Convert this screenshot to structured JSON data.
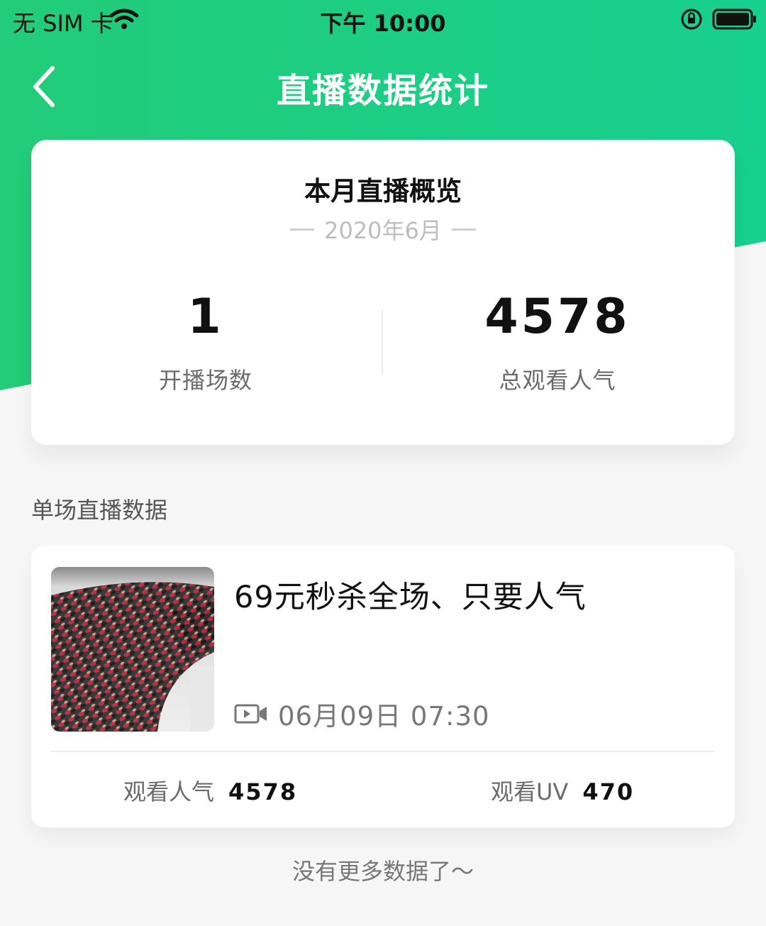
{
  "status_bar": {
    "carrier": "无 SIM 卡",
    "time": "下午 10:00"
  },
  "header": {
    "title": "直播数据统计",
    "back_icon": "chevron-left-icon",
    "accent_color": "#1fcc84"
  },
  "overview": {
    "title": "本月直播概览",
    "month": "2020年6月",
    "stats": [
      {
        "value": "1",
        "label": "开播场数"
      },
      {
        "value": "4578",
        "label": "总观看人气"
      }
    ]
  },
  "section": {
    "title": "单场直播数据"
  },
  "sessions": [
    {
      "title": "69元秒杀全场、只要人气",
      "time_icon": "video-camera-icon",
      "time": "06月09日 07:30",
      "metrics": [
        {
          "label": "观看人气",
          "value": "4578"
        },
        {
          "label": "观看UV",
          "value": "470"
        }
      ]
    }
  ],
  "footer": {
    "text": "没有更多数据了～"
  }
}
